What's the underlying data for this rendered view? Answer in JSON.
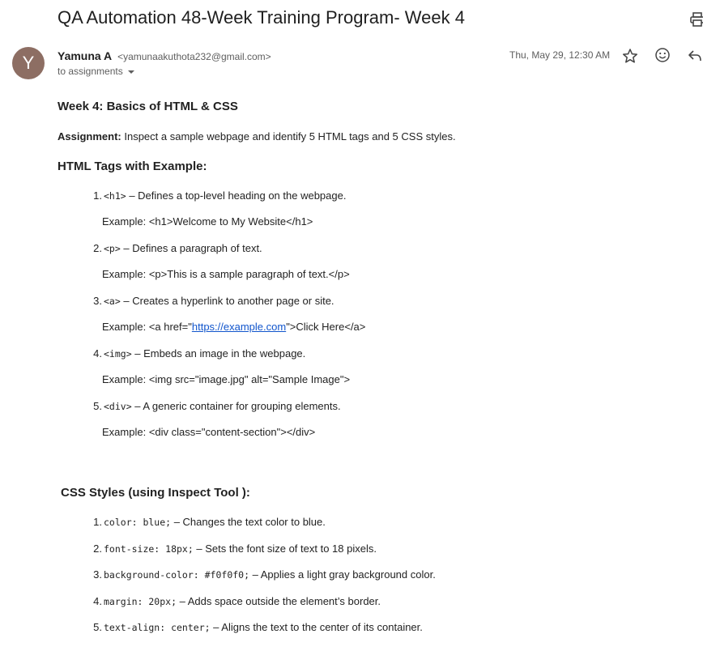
{
  "email": {
    "subject": "QA Automation 48-Week Training Program- Week 4",
    "sender_initial": "Y",
    "sender_name": "Yamuna A",
    "sender_email": "<yamunaakuthota232@gmail.com>",
    "to_line": "to assignments",
    "date": "Thu, May 29, 12:30 AM"
  },
  "icons": {
    "print": "print-icon",
    "star": "star-icon",
    "emoji": "emoji-icon",
    "reply": "reply-icon",
    "dropdown": "chevron-down-icon"
  },
  "content": {
    "heading": "Week 4: Basics of HTML & CSS",
    "assignment_label": "Assignment:",
    "assignment_text": " Inspect a sample webpage and identify 5 HTML tags and 5 CSS styles.",
    "html_heading": "HTML Tags with Example:",
    "html_tags": [
      {
        "num": "1.",
        "tag": "<h1>",
        "desc": " – Defines a top-level heading on the webpage.",
        "ex_label": "Example:  ",
        "ex_code": "<h1>Welcome to My Website</h1>"
      },
      {
        "num": "2.",
        "tag": "<p>",
        "desc": " – Defines a paragraph of text.",
        "ex_label": "Example:  ",
        "ex_code": "<p>This is a sample paragraph of text.</p>"
      },
      {
        "num": "3.",
        "tag": "<a>",
        "desc": " – Creates a hyperlink to another page or site.",
        "ex_label": "Example:  ",
        "ex_pre": "<a href=\"",
        "ex_link": "https://example.com",
        "ex_post": "\">Click Here</a>"
      },
      {
        "num": "4.",
        "tag": "<img>",
        "desc": " – Embeds an image in the webpage.",
        "ex_label": "Example:  ",
        "ex_code": "<img src=\"image.jpg\" alt=\"Sample Image\">"
      },
      {
        "num": "5.",
        "tag": "<div>",
        "desc": " – A generic container for grouping elements.",
        "ex_label": "Example:  ",
        "ex_code": "<div class=\"content-section\"></div>"
      }
    ],
    "css_heading": "CSS Styles (using Inspect Tool ):",
    "css_styles": [
      {
        "num": "1.",
        "code": "color: blue;",
        "desc": " – Changes the text color to blue."
      },
      {
        "num": "2.",
        "code": "font-size: 18px;",
        "desc": " – Sets the font size of text to 18 pixels."
      },
      {
        "num": "3.",
        "code": "background-color: #f0f0f0;",
        "desc": " – Applies a light gray background color."
      },
      {
        "num": "4.",
        "code": "margin: 20px;",
        "desc": " – Adds space outside the element’s border."
      },
      {
        "num": "5.",
        "code": "text-align: center;",
        "desc": " – Aligns the text to the center of its container."
      }
    ]
  }
}
